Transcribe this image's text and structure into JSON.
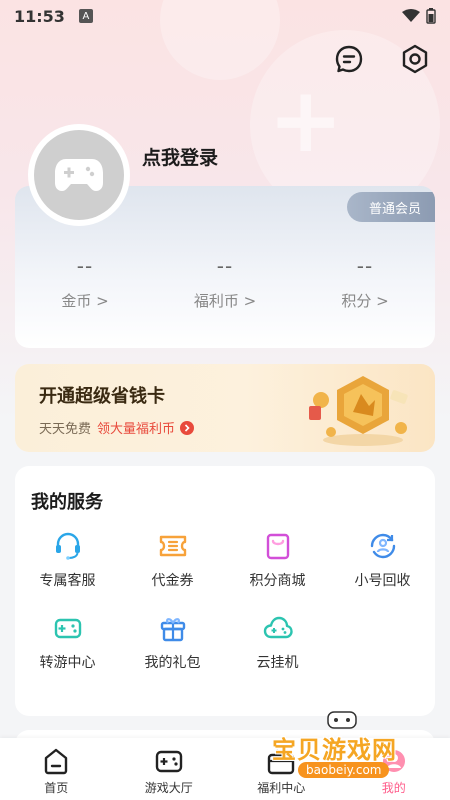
{
  "status_bar": {
    "time": "11:53",
    "notification": "A"
  },
  "header": {
    "message_icon": "message-icon",
    "settings_icon": "settings-hexagon-icon"
  },
  "profile": {
    "login_prompt": "点我登录",
    "avatar_icon": "gamepad-icon"
  },
  "member_card": {
    "badge": "普通会员",
    "stats": [
      {
        "value": "--",
        "label": "金币 >"
      },
      {
        "value": "--",
        "label": "福利币 >"
      },
      {
        "value": "--",
        "label": "积分 >"
      }
    ]
  },
  "promo": {
    "title": "开通超级省钱卡",
    "subtitle_plain": "天天免费",
    "subtitle_highlight": "领大量福利币"
  },
  "services": {
    "title": "我的服务",
    "items": [
      {
        "label": "专属客服",
        "icon": "headset-icon",
        "color": "#2aa6e8"
      },
      {
        "label": "代金券",
        "icon": "coupon-icon",
        "color": "#f7a23a"
      },
      {
        "label": "积分商城",
        "icon": "shopping-bag-icon",
        "color": "#d24fd8"
      },
      {
        "label": "小号回收",
        "icon": "recycle-user-icon",
        "color": "#3f8be8"
      },
      {
        "label": "转游中心",
        "icon": "transfer-game-icon",
        "color": "#2cc4b0"
      },
      {
        "label": "我的礼包",
        "icon": "gift-icon",
        "color": "#3f8be8"
      },
      {
        "label": "云挂机",
        "icon": "cloud-game-icon",
        "color": "#2cc4b0"
      }
    ]
  },
  "tabbar": {
    "items": [
      {
        "label": "首页",
        "icon": "home-icon"
      },
      {
        "label": "游戏大厅",
        "icon": "gamepad-icon"
      },
      {
        "label": "福利中心",
        "icon": "gift-box-icon"
      },
      {
        "label": "我的",
        "icon": "profile-icon",
        "active": true
      }
    ]
  },
  "watermark": {
    "main": "宝贝游戏网",
    "url": "baobeiy.com"
  },
  "colors": {
    "accent": "#ff5b8a",
    "promo_red": "#e84a3c",
    "badge": "#9aa8be"
  }
}
